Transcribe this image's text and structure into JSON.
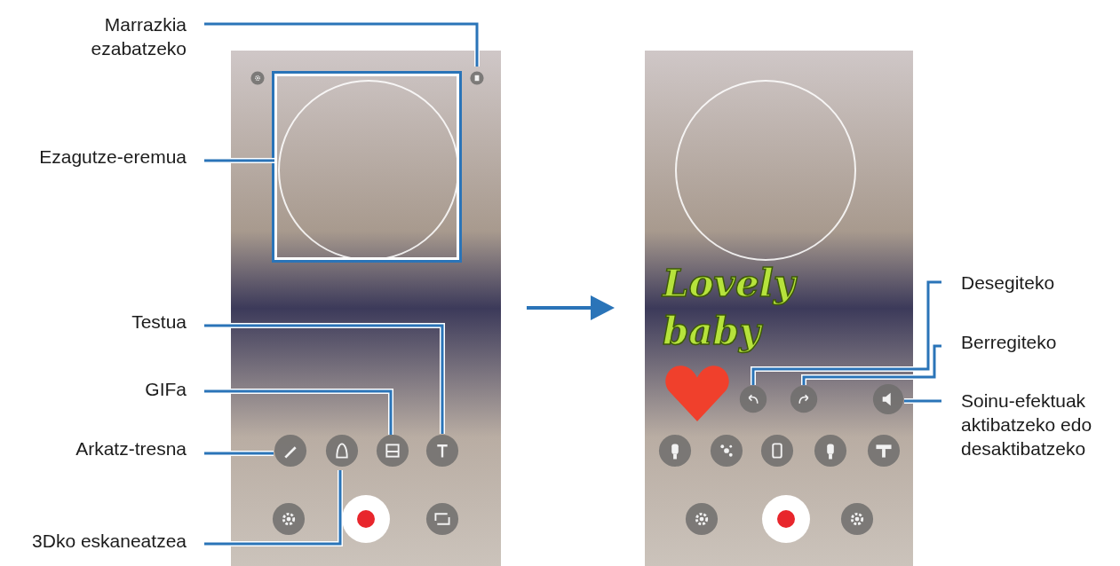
{
  "left_screen": {
    "callouts": [
      "Marrazkia ezabatzeko",
      "Ezagutze-eremua",
      "Testua",
      "GIFa",
      "Arkatz-tresna",
      "3Dko eskaneatzea"
    ]
  },
  "right_screen": {
    "doodle_text": "Lovely baby",
    "callouts": [
      "Desegiteko",
      "Berregiteko",
      "Soinu-efektuak aktibatzeko edo desaktibatzeko"
    ]
  }
}
